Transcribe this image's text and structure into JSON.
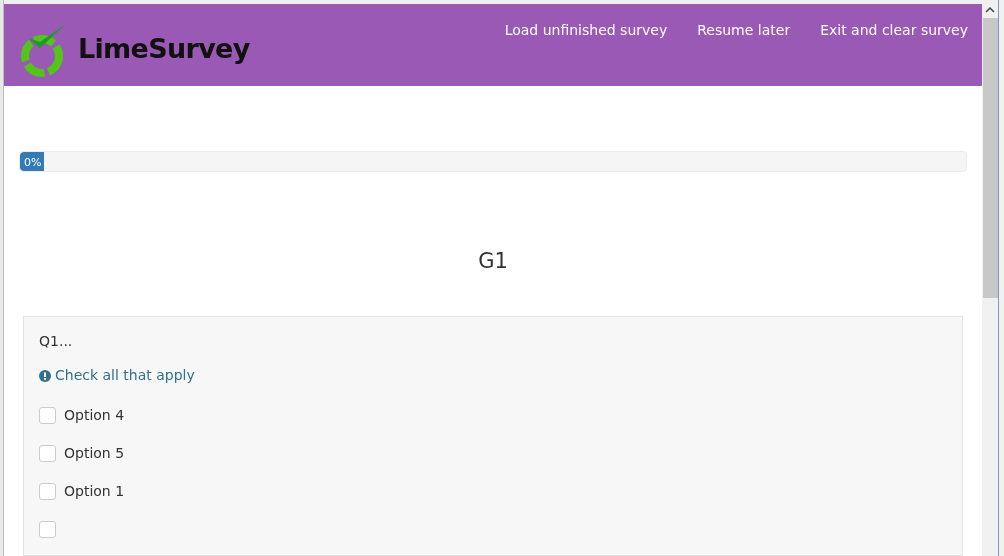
{
  "header": {
    "logo": "LimeSurvey",
    "links": [
      "Load unfinished survey",
      "Resume later",
      "Exit and clear survey"
    ]
  },
  "progress": {
    "level": 0.0,
    "label": "0%"
  },
  "group": {
    "title": "G1"
  },
  "question": {
    "title": "Q1...",
    "hint": "Check all that apply",
    "options": [
      {
        "label": "Option 4",
        "checked": false
      },
      {
        "label": "Option 5",
        "checked": false
      },
      {
        "label": "Option 1",
        "checked": false
      },
      {
        "checked": false
      }
    ]
  }
}
